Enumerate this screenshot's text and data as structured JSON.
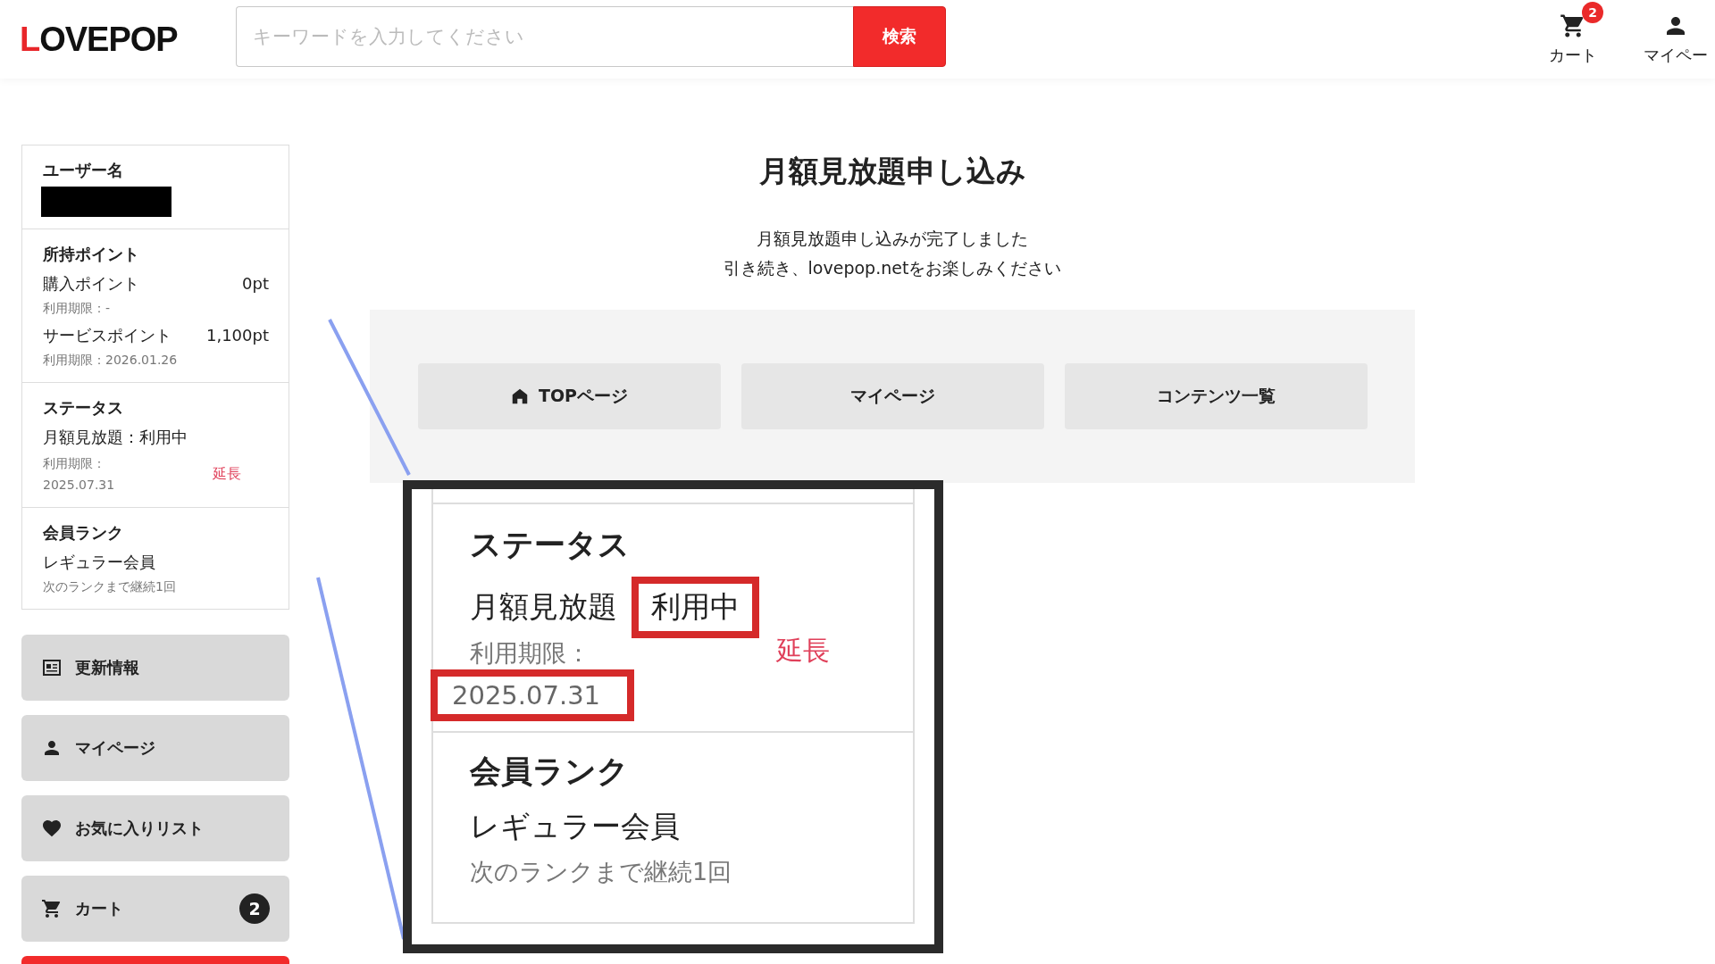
{
  "header": {
    "logo": {
      "initial": "L",
      "rest": "OVEPOP"
    },
    "search": {
      "placeholder": "キーワードを入力してください",
      "button": "検索"
    },
    "nav": [
      {
        "kind": "cart",
        "label": "カート",
        "badge": "2"
      },
      {
        "kind": "user",
        "label": "マイペー"
      }
    ]
  },
  "sidebar": {
    "user": {
      "title": "ユーザー名"
    },
    "points": {
      "title": "所持ポイント",
      "items": [
        {
          "label": "購入ポイント",
          "value": "0pt",
          "expiry": "利用期限：-"
        },
        {
          "label": "サービスポイント",
          "value": "1,100pt",
          "expiry": "利用期限：2026.01.26"
        }
      ]
    },
    "status": {
      "title": "ステータス",
      "text": "月額見放題：利用中",
      "expiry_label": "利用期限：",
      "expiry_date": "2025.07.31",
      "extend": "延長"
    },
    "rank": {
      "title": "会員ランク",
      "text": "レギュラー会員",
      "note": "次のランクまで継続1回"
    },
    "menu": [
      {
        "kind": "news",
        "label": "更新情報"
      },
      {
        "kind": "user",
        "label": "マイページ"
      },
      {
        "kind": "heart",
        "label": "お気に入りリスト"
      },
      {
        "kind": "cart",
        "label": "カート",
        "badge": "2"
      }
    ]
  },
  "main": {
    "title": "月額見放題申し込み",
    "message": [
      "月額見放題申し込みが完了しました",
      "引き続き、lovepop.netをお楽しみください"
    ],
    "buttons": [
      {
        "kind": "home",
        "label": "TOPページ"
      },
      {
        "kind": "plain",
        "label": "マイページ"
      },
      {
        "kind": "plain",
        "label": "コンテンツ一覧"
      }
    ]
  },
  "callout": {
    "status_title": "ステータス",
    "plan": "月額見放題",
    "plan_state": {
      "text": "利用中",
      "highlighted": true
    },
    "expiry_label": "利用期限：",
    "expiry_date": {
      "text": "2025.07.31",
      "highlighted": true
    },
    "extend": "延長",
    "rank_title": "会員ランク",
    "rank_text": "レギュラー会員",
    "rank_note": "次のランクまで継続1回"
  }
}
